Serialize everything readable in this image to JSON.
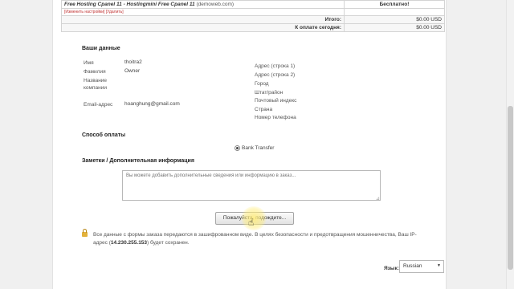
{
  "summary": {
    "product_name": "Free Hosting Cpanel 11 - Hostingmini Free Cpanel 11",
    "product_domain": "(demoweb.com)",
    "product_price": "Бесплатно!",
    "edit_link": "[Изменить настройки]",
    "remove_link": "[Удалить]",
    "total_label": "Итого:",
    "total_value": "$0.00 USD",
    "due_today_label": "К оплате сегодня:",
    "due_today_value": "$0.00 USD"
  },
  "your_details": {
    "title": "Ваши данные",
    "first_name_label": "Имя",
    "first_name_value": "thoitra2",
    "last_name_label": "Фамилия",
    "last_name_value": "Owner",
    "company_label_line1": "Название",
    "company_label_line2": "компании",
    "email_label": "Email-адрес",
    "email_value": "hoanghung@gmail.com",
    "address1_label": "Адрес (строка 1)",
    "address2_label": "Адрес (строка 2)",
    "city_label": "Город",
    "state_label": "Штат/район",
    "postcode_label": "Почтовый индекс",
    "country_label": "Страна",
    "phone_label": "Номер телефона"
  },
  "payment": {
    "title": "Способ оплаты",
    "method": "Bank Transfer"
  },
  "notes": {
    "title": "Заметки / Дополнительная информация",
    "placeholder": "Вы можете добавить дополнительные сведения или информацию в заказ..."
  },
  "submit": {
    "label": "Пожалуйста, подождите..."
  },
  "security": {
    "text_before": "Все данные с формы заказа передаются в зашифрованном виде. В целях безопасности и предотвращения мошенничества, Ваш IP-адрес (",
    "ip": "14.230.255.153",
    "text_after": ") будет сохранен."
  },
  "language": {
    "label": "Язык:",
    "selected": "Russian"
  },
  "icons": {
    "lock": "lock-icon",
    "radio": "radio-selected-icon",
    "cursor": "hand-pointer-icon",
    "dropdown": "chevron-down-icon"
  }
}
